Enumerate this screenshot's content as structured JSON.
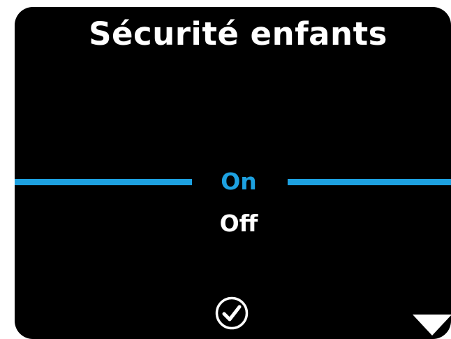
{
  "screen": {
    "title": "Sécurité enfants"
  },
  "options": {
    "items": [
      {
        "label": "On",
        "selected": true
      },
      {
        "label": "Off",
        "selected": false
      }
    ]
  },
  "icons": {
    "confirm": "check-circle-icon",
    "scroll_down": "triangle-down-icon"
  },
  "colors": {
    "background": "#000000",
    "accent": "#1da1e0",
    "text": "#ffffff"
  }
}
